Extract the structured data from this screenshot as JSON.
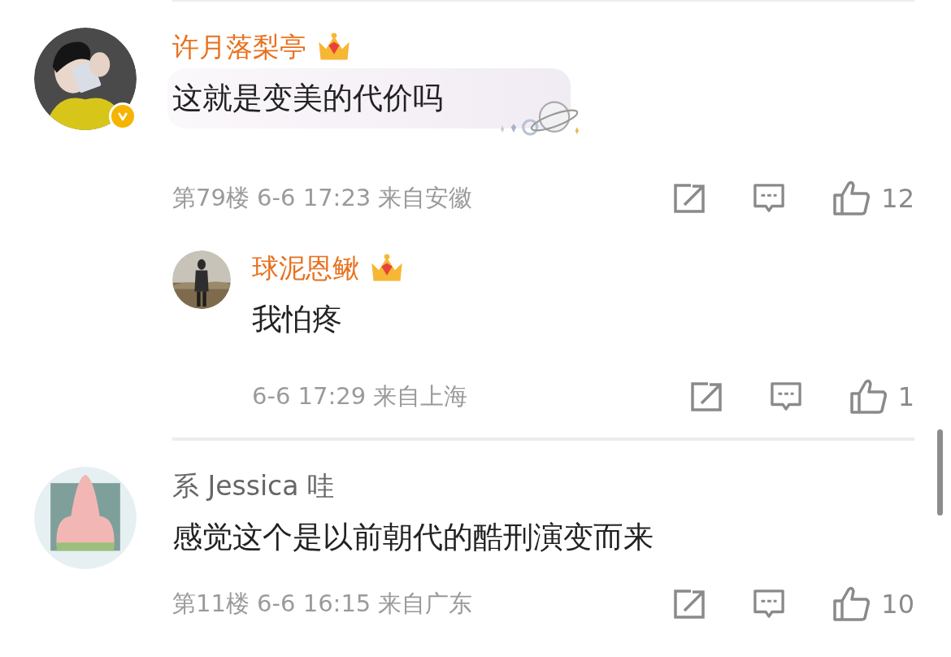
{
  "comments": [
    {
      "name": "许月落梨亭",
      "vip": true,
      "verified": true,
      "bubble": true,
      "text": "这就是变美的代价吗",
      "meta": "第79楼 6-6 17:23 来自安徽",
      "likes": "12",
      "replies": [
        {
          "name": "球泥恩鳅",
          "vip": true,
          "text": "我怕疼",
          "meta": "6-6 17:29 来自上海",
          "likes": "1"
        }
      ]
    },
    {
      "name": "系 Jessica 哇",
      "vip": false,
      "verified": false,
      "bubble": false,
      "text": "感觉这个是以前朝代的酷刑演变而来",
      "meta": "第11楼 6-6 16:15 来自广东",
      "likes": "10"
    }
  ]
}
